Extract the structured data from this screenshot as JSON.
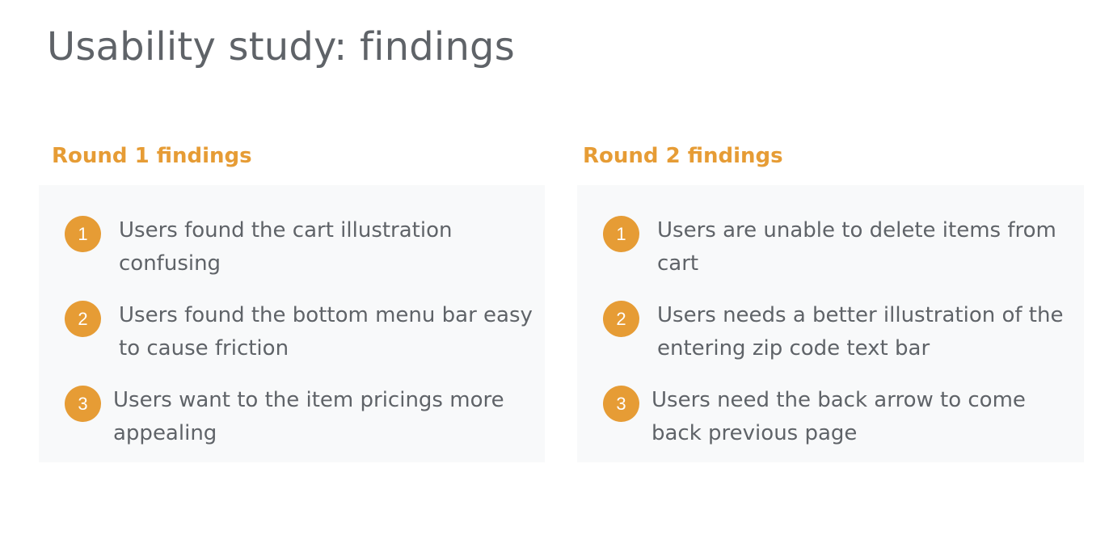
{
  "page": {
    "title": "Usability study: findings"
  },
  "colors": {
    "accent": "#e69c35",
    "text": "#5f6368",
    "card_background": "#f8f9fa"
  },
  "rounds": [
    {
      "heading": "Round 1 findings",
      "findings": [
        {
          "number": "1",
          "text": "Users found the cart illustration confusing"
        },
        {
          "number": "2",
          "text": "Users found the bottom menu bar easy to cause friction"
        },
        {
          "number": "3",
          "text": "Users want to the item pricings more appealing"
        }
      ]
    },
    {
      "heading": "Round 2 findings",
      "findings": [
        {
          "number": "1",
          "text": "Users are unable to delete items from cart"
        },
        {
          "number": "2",
          "text": "Users needs a better illustration of the entering zip code text bar"
        },
        {
          "number": "3",
          "text": "Users need the back arrow to come back previous page"
        }
      ]
    }
  ]
}
